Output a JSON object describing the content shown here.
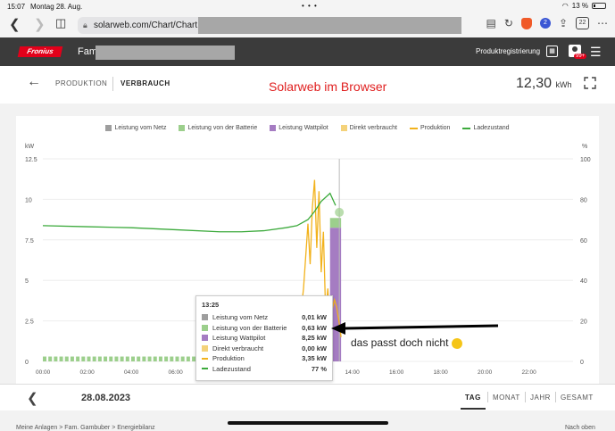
{
  "status_bar": {
    "time": "15:07",
    "date": "Montag 28. Aug.",
    "battery": "13 %"
  },
  "browser": {
    "url": "solarweb.com/Chart/Chart",
    "tab_count": "22"
  },
  "header": {
    "logo": "Fronius",
    "fam_label": "Fam.",
    "product_registration": "Produktregistrierung",
    "notification_badge": "99+"
  },
  "subheader": {
    "tabs": [
      "PRODUKTION",
      "VERBRAUCH"
    ],
    "active_tab": "VERBRAUCH",
    "overlay_title": "Solarweb im Browser",
    "total_value": "12,30",
    "total_unit": "kWh"
  },
  "chart_data": {
    "type": "bar",
    "xlabel": "",
    "ylabel_left": "kW",
    "ylabel_right": "%",
    "ylim_left": [
      0,
      12.5
    ],
    "ylim_right": [
      0,
      100
    ],
    "y_ticks_left": [
      "0",
      "2.5",
      "5",
      "7.5",
      "10",
      "12.5"
    ],
    "y_ticks_right": [
      "0",
      "20",
      "40",
      "60",
      "80",
      "100"
    ],
    "x_ticks": [
      "00:00",
      "02:00",
      "04:00",
      "06:00",
      "08:00",
      "10:00",
      "12:00",
      "14:00",
      "16:00",
      "18:00",
      "20:00",
      "22:00"
    ],
    "legend": [
      {
        "name": "Leistung vom Netz",
        "color": "#9e9e9e",
        "kind": "box"
      },
      {
        "name": "Leistung von der Batterie",
        "color": "#9ccf8c",
        "kind": "box"
      },
      {
        "name": "Leistung Wattpilot",
        "color": "#a57cc2",
        "kind": "box"
      },
      {
        "name": "Direkt verbraucht",
        "color": "#f4d27a",
        "kind": "box"
      },
      {
        "name": "Produktion",
        "color": "#f2b21c",
        "kind": "line"
      },
      {
        "name": "Ladezustand",
        "color": "#3caa3c",
        "kind": "line"
      }
    ],
    "series": [
      {
        "name": "Ladezustand",
        "axis": "right",
        "x_hours": [
          0,
          2,
          4,
          6,
          8,
          9,
          10,
          11,
          11.5,
          12,
          12.3,
          12.6,
          13,
          13.25
        ],
        "values": [
          67,
          66.5,
          66,
          65,
          64,
          64,
          64.5,
          66,
          67,
          70,
          74,
          79,
          83,
          77
        ]
      },
      {
        "name": "Produktion",
        "axis": "left",
        "x_hours": [
          11.6,
          11.8,
          12.0,
          12.1,
          12.2,
          12.3,
          12.4,
          12.5,
          12.6,
          12.7,
          12.8,
          12.9,
          13.0,
          13.1,
          13.2,
          13.3,
          13.4,
          13.5
        ],
        "values": [
          2.0,
          4.5,
          8.5,
          6.0,
          9.5,
          11.2,
          7.0,
          10.5,
          5.5,
          8.0,
          3.0,
          4.5,
          2.0,
          3.2,
          3.8,
          3.35,
          2.5,
          1.5
        ]
      },
      {
        "name": "Leistung Wattpilot",
        "axis": "left",
        "x_hours": [
          13.0,
          13.5
        ],
        "values": [
          8.25,
          8.25
        ]
      },
      {
        "name": "Leistung von der Batterie",
        "axis": "left",
        "x_hours": [
          0,
          2,
          4,
          6,
          8,
          10,
          12,
          13
        ],
        "values": [
          0.3,
          0.3,
          0.3,
          0.3,
          0.3,
          0.3,
          0.3,
          0.63
        ]
      }
    ],
    "cursor_x_hour": 13.42
  },
  "tooltip": {
    "time": "13:25",
    "rows": [
      {
        "label": "Leistung vom Netz",
        "value": "0,01 kW",
        "color": "#9e9e9e",
        "kind": "box"
      },
      {
        "label": "Leistung von der Batterie",
        "value": "0,63 kW",
        "color": "#9ccf8c",
        "kind": "box"
      },
      {
        "label": "Leistung Wattpilot",
        "value": "8,25 kW",
        "color": "#a57cc2",
        "kind": "box"
      },
      {
        "label": "Direkt verbraucht",
        "value": "0,00 kW",
        "color": "#f4d27a",
        "kind": "box"
      },
      {
        "label": "Produktion",
        "value": "3,35 kW",
        "color": "#f2b21c",
        "kind": "line"
      },
      {
        "label": "Ladezustand",
        "value": "77 %",
        "color": "#3caa3c",
        "kind": "line"
      }
    ]
  },
  "annotation": {
    "text": "das passt doch nicht"
  },
  "footer": {
    "date": "28.08.2023",
    "ranges": [
      "TAG",
      "MONAT",
      "JAHR",
      "GESAMT"
    ],
    "active_range": "TAG"
  },
  "bottom": {
    "breadcrumb": "Meine Anlagen  >  Fam. Gambuber  >  Energiebilanz",
    "scroll_top": "Nach oben"
  }
}
